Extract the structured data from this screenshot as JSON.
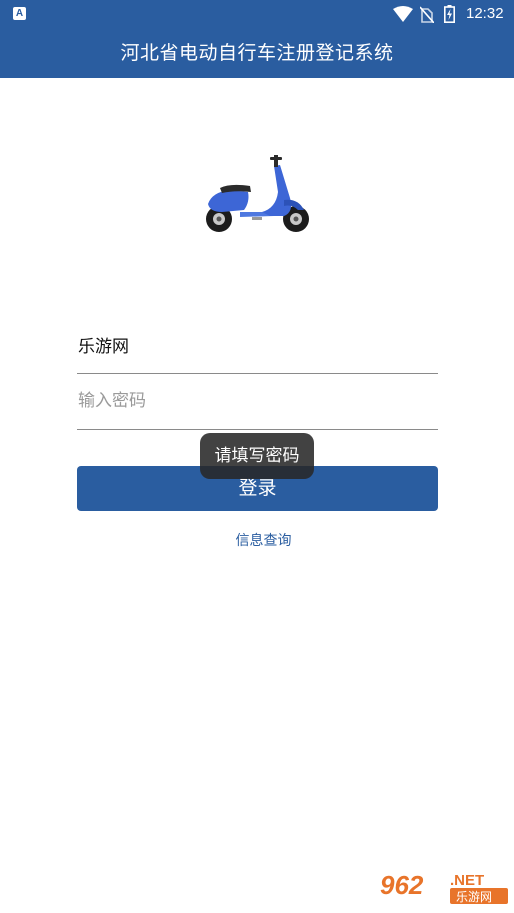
{
  "status_bar": {
    "time": "12:32",
    "app_badge": "A",
    "icons": [
      "app-notification-icon",
      "wifi-icon",
      "no-sim-icon",
      "battery-charging-icon"
    ]
  },
  "app_bar": {
    "title": "河北省电动自行车注册登记系统"
  },
  "logo": {
    "icon": "electric-scooter-icon",
    "color": "#3d66d6"
  },
  "form": {
    "username_value": "乐游网",
    "password_placeholder": "输入密码",
    "login_label": "登录",
    "query_link": "信息查询"
  },
  "toast": {
    "message": "请填写密码"
  },
  "watermark": {
    "text_number": "962",
    "text_net": ".NET",
    "text_cn": "乐游网"
  },
  "colors": {
    "primary": "#2a5da0",
    "white": "#ffffff"
  }
}
